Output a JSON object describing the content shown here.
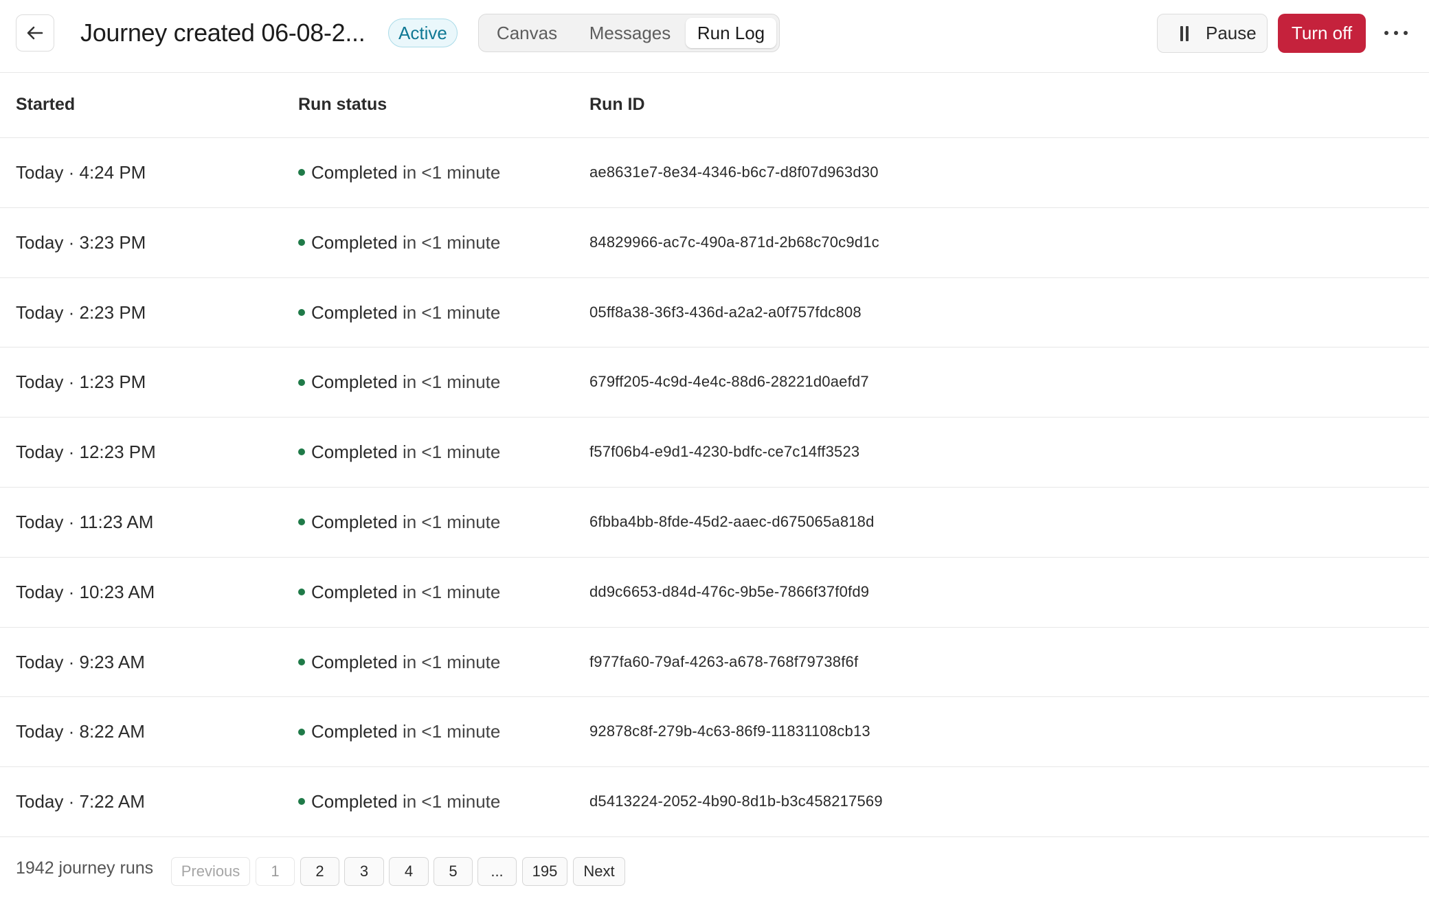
{
  "header": {
    "back_icon": "arrow-left-icon",
    "title": "Journey created 06-08-2...",
    "status_badge": "Active",
    "tabs": [
      {
        "label": "Canvas",
        "active": false
      },
      {
        "label": "Messages",
        "active": false
      },
      {
        "label": "Run Log",
        "active": true
      }
    ],
    "pause_icon": "pause-icon",
    "pause_label": "Pause",
    "turn_off_label": "Turn off",
    "more_icon": "more-horizontal-icon"
  },
  "table": {
    "columns": [
      "Started",
      "Run status",
      "Run ID"
    ],
    "rows": [
      {
        "started": "Today · 4:24 PM",
        "status": "Completed",
        "duration": "in <1 minute",
        "run_id": "ae8631e7-8e34-4346-b6c7-d8f07d963d30"
      },
      {
        "started": "Today · 3:23 PM",
        "status": "Completed",
        "duration": "in <1 minute",
        "run_id": "84829966-ac7c-490a-871d-2b68c70c9d1c"
      },
      {
        "started": "Today · 2:23 PM",
        "status": "Completed",
        "duration": "in <1 minute",
        "run_id": "05ff8a38-36f3-436d-a2a2-a0f757fdc808"
      },
      {
        "started": "Today · 1:23 PM",
        "status": "Completed",
        "duration": "in <1 minute",
        "run_id": "679ff205-4c9d-4e4c-88d6-28221d0aefd7"
      },
      {
        "started": "Today · 12:23 PM",
        "status": "Completed",
        "duration": "in <1 minute",
        "run_id": "f57f06b4-e9d1-4230-bdfc-ce7c14ff3523"
      },
      {
        "started": "Today · 11:23 AM",
        "status": "Completed",
        "duration": "in <1 minute",
        "run_id": "6fbba4bb-8fde-45d2-aaec-d675065a818d"
      },
      {
        "started": "Today · 10:23 AM",
        "status": "Completed",
        "duration": "in <1 minute",
        "run_id": "dd9c6653-d84d-476c-9b5e-7866f37f0fd9"
      },
      {
        "started": "Today · 9:23 AM",
        "status": "Completed",
        "duration": "in <1 minute",
        "run_id": "f977fa60-79af-4263-a678-768f79738f6f"
      },
      {
        "started": "Today · 8:22 AM",
        "status": "Completed",
        "duration": "in <1 minute",
        "run_id": "92878c8f-279b-4c63-86f9-11831108cb13"
      },
      {
        "started": "Today · 7:22 AM",
        "status": "Completed",
        "duration": "in <1 minute",
        "run_id": "d5413224-2052-4b90-8d1b-b3c458217569"
      }
    ]
  },
  "footer": {
    "run_count": "1942 journey runs",
    "previous_label": "Previous",
    "pages": [
      "1",
      "2",
      "3",
      "4",
      "5",
      "...",
      "195"
    ],
    "current_page": "1",
    "next_label": "Next"
  },
  "colors": {
    "status_completed": "#1f7a48",
    "turn_off": "#c5223c",
    "active_badge_text": "#0f7894",
    "active_badge_bg": "#eaf7fb"
  }
}
